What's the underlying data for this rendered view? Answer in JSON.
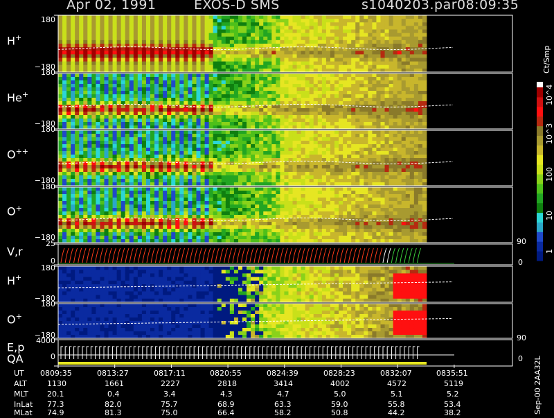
{
  "title": {
    "date": "Apr 02, 1991",
    "instrument": "EXOS-D SMS",
    "file": "s1040203.par",
    "time": "08:09:35"
  },
  "side_label": "Sep-00 2AA32L",
  "chart_data": {
    "type": "heatmap",
    "colorbar": {
      "label": "Ct/Smp",
      "ticks": [
        "1",
        "10",
        "100",
        "10^3",
        "10^4"
      ],
      "scale": "log",
      "range": [
        1,
        10000
      ]
    },
    "panels": [
      {
        "id": "h_plus_1",
        "label": "H",
        "sup": "+",
        "ytop": "180",
        "ybot": "−180"
      },
      {
        "id": "he_plus",
        "label": "He",
        "sup": "+",
        "ytop": "180",
        "ybot": "−180"
      },
      {
        "id": "o_pp",
        "label": "O",
        "sup": "++",
        "ytop": "180",
        "ybot": "−180"
      },
      {
        "id": "o_plus_1",
        "label": "O",
        "sup": "+",
        "ytop": "180",
        "ybot": "−180"
      },
      {
        "id": "vr",
        "label": "V,r",
        "sup": "",
        "ytop": "25",
        "ybot": "0",
        "rtop": "90",
        "rbot": "0"
      },
      {
        "id": "h_plus_2",
        "label": "H",
        "sup": "+",
        "ytop": "180",
        "ybot": "−180"
      },
      {
        "id": "o_plus_2",
        "label": "O",
        "sup": "+",
        "ytop": "180",
        "ybot": "−180",
        "rtop": "90"
      },
      {
        "id": "ep",
        "label": "E,p",
        "sup": "",
        "ytop": "4000",
        "ybot": "0",
        "rbot": "0"
      }
    ],
    "qa_label": "QA",
    "x_axis_times": [
      "0809:35",
      "0813:27",
      "0817:11",
      "0820:55",
      "0824:39",
      "0828:23",
      "0832:07",
      "0835:51"
    ]
  },
  "ephemeris": [
    {
      "name": "UT",
      "values": [
        "0809:35",
        "0813:27",
        "0817:11",
        "0820:55",
        "0824:39",
        "0828:23",
        "0832:07",
        "0835:51"
      ]
    },
    {
      "name": "ALT",
      "values": [
        "1130",
        "1661",
        "2227",
        "2818",
        "3414",
        "4002",
        "4572",
        "5119"
      ]
    },
    {
      "name": "MLT",
      "values": [
        "20.1",
        "0.4",
        "3.4",
        "4.3",
        "4.7",
        "5.0",
        "5.1",
        "5.2"
      ]
    },
    {
      "name": "InLat",
      "values": [
        "77.3",
        "82.0",
        "75.7",
        "68.9",
        "63.3",
        "59.0",
        "55.8",
        "53.4"
      ]
    },
    {
      "name": "MLat",
      "values": [
        "74.9",
        "81.3",
        "75.0",
        "66.4",
        "58.2",
        "50.8",
        "44.2",
        "38.2"
      ]
    }
  ]
}
